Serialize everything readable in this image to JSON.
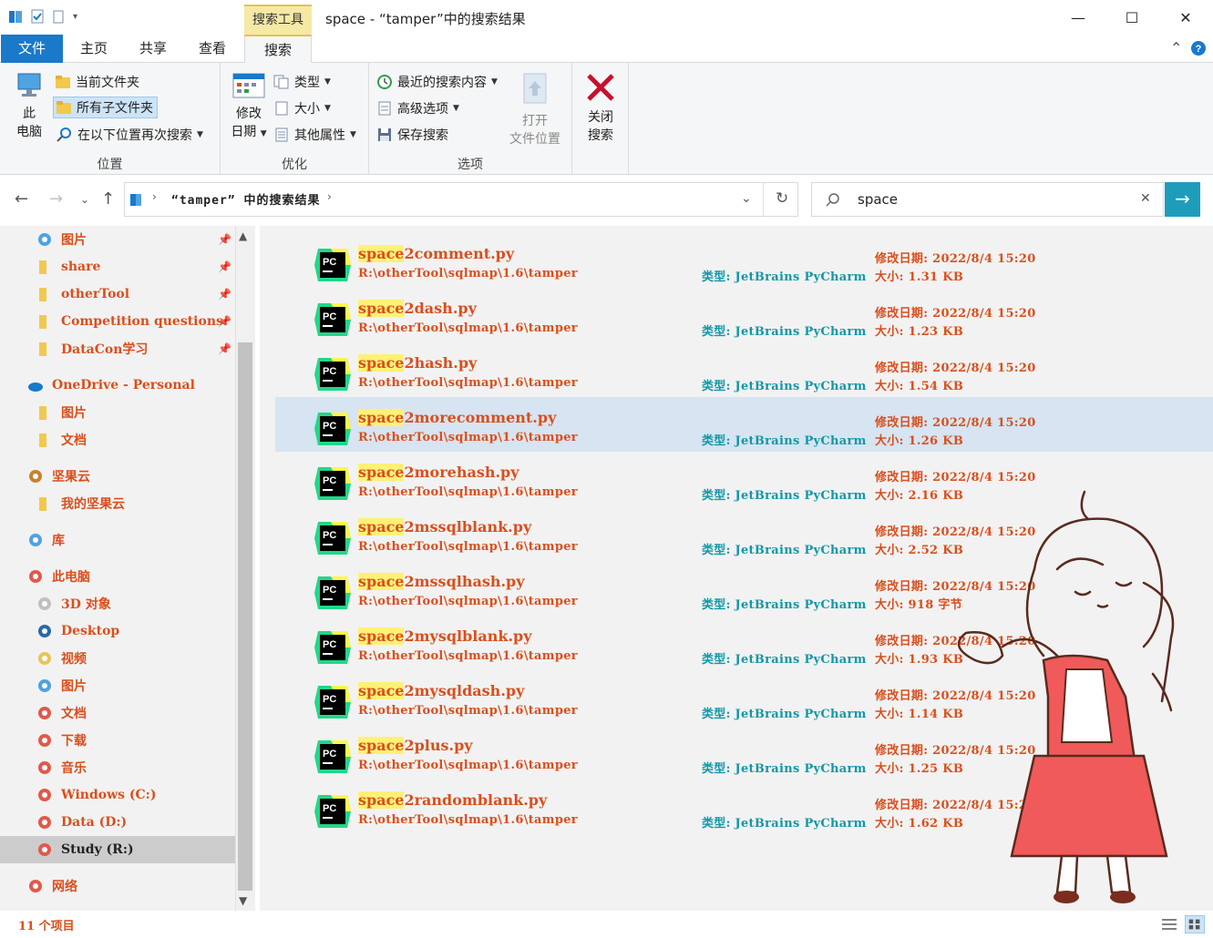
{
  "window": {
    "title": "space - “tamper”中的搜索结果",
    "context_tab_title": "搜索工具",
    "minimize": "—",
    "maximize": "☐",
    "close": "✕"
  },
  "ribbon_tabs": {
    "file": "文件",
    "home": "主页",
    "share": "共享",
    "view": "查看",
    "search": "搜索"
  },
  "ribbon": {
    "location": {
      "label": "位置",
      "this_pc_line1": "此",
      "this_pc_line2": "电脑",
      "current_folder": "当前文件夹",
      "all_subfolders": "所有子文件夹",
      "search_again_in": "在以下位置再次搜索"
    },
    "refine": {
      "label": "优化",
      "date_modified_line1": "修改",
      "date_modified_line2": "日期",
      "kind": "类型",
      "size": "大小",
      "other_properties": "其他属性"
    },
    "options": {
      "label": "选项",
      "recent_searches": "最近的搜索内容",
      "advanced_options": "高级选项",
      "save_search": "保存搜索",
      "open_location_line1": "打开",
      "open_location_line2": "文件位置"
    },
    "close_search": {
      "line1": "关闭",
      "line2": "搜索"
    }
  },
  "address": {
    "path": "“tamper” 中的搜索结果"
  },
  "search": {
    "query": "space",
    "clear": "✕"
  },
  "nav": {
    "items": [
      {
        "label": "图片",
        "icon": "pictures-icon",
        "pinned": true
      },
      {
        "label": "share",
        "icon": "folder-icon",
        "pinned": true
      },
      {
        "label": "otherTool",
        "icon": "folder-icon",
        "pinned": true
      },
      {
        "label": "Competition questions",
        "icon": "folder-icon",
        "pinned": true
      },
      {
        "label": "DataCon学习",
        "icon": "folder-icon",
        "pinned": true
      },
      {
        "label": "OneDrive - Personal",
        "icon": "onedrive-icon",
        "pinned": false
      },
      {
        "label": "图片",
        "icon": "folder-icon",
        "pinned": false
      },
      {
        "label": "文档",
        "icon": "folder-icon",
        "pinned": false
      },
      {
        "label": "坚果云",
        "icon": "nutstore-icon",
        "pinned": false
      },
      {
        "label": "我的坚果云",
        "icon": "folder-icon",
        "pinned": false
      },
      {
        "label": "库",
        "icon": "library-icon",
        "pinned": false
      },
      {
        "label": "此电脑",
        "icon": "this-pc-icon",
        "pinned": false
      },
      {
        "label": "3D 对象",
        "icon": "3d-objects-icon",
        "pinned": false
      },
      {
        "label": "Desktop",
        "icon": "desktop-icon",
        "pinned": false
      },
      {
        "label": "视频",
        "icon": "videos-icon",
        "pinned": false
      },
      {
        "label": "图片",
        "icon": "pictures-icon",
        "pinned": false
      },
      {
        "label": "文档",
        "icon": "documents-icon",
        "pinned": false
      },
      {
        "label": "下载",
        "icon": "downloads-icon",
        "pinned": false
      },
      {
        "label": "音乐",
        "icon": "music-icon",
        "pinned": false
      },
      {
        "label": "Windows (C:)",
        "icon": "drive-icon",
        "pinned": false
      },
      {
        "label": "Data (D:)",
        "icon": "drive-icon",
        "pinned": false
      },
      {
        "label": "Study (R:)",
        "icon": "drive-icon",
        "pinned": false
      },
      {
        "label": "网络",
        "icon": "network-icon",
        "pinned": false
      }
    ]
  },
  "results": {
    "match": "space",
    "path": "R:\\otherTool\\sqlmap\\1.6\\tamper",
    "type_label": "类型: JetBrains PyCharm",
    "date_label": "修改日期: 2022/8/4 15:20",
    "size_prefix": "大小: ",
    "files": [
      {
        "rest": "2comment.py",
        "size": "1.31 KB"
      },
      {
        "rest": "2dash.py",
        "size": "1.23 KB"
      },
      {
        "rest": "2hash.py",
        "size": "1.54 KB"
      },
      {
        "rest": "2morecomment.py",
        "size": "1.26 KB"
      },
      {
        "rest": "2morehash.py",
        "size": "2.16 KB"
      },
      {
        "rest": "2mssqlblank.py",
        "size": "2.52 KB"
      },
      {
        "rest": "2mssqlhash.py",
        "size": "918 字节"
      },
      {
        "rest": "2mysqlblank.py",
        "size": "1.93 KB"
      },
      {
        "rest": "2mysqldash.py",
        "size": "1.14 KB"
      },
      {
        "rest": "2plus.py",
        "size": "1.25 KB"
      },
      {
        "rest": "2randomblank.py",
        "size": "1.62 KB"
      }
    ]
  },
  "status": {
    "count": "11 个项目"
  },
  "colors": {
    "accent": "#1979ca",
    "search_go": "#1e9dbb",
    "text_orange": "#d94f1d",
    "text_teal": "#1497a8",
    "highlight": "#fff176",
    "context_tab": "#f6e9a6"
  }
}
